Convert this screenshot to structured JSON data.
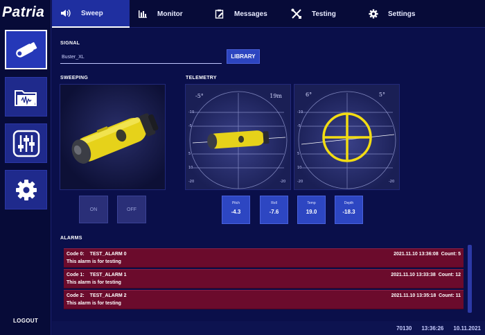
{
  "brand": {
    "logo_text": "Patria"
  },
  "rail": {
    "items": [
      {
        "name": "torpedo",
        "icon": "torpedo-icon",
        "active": true
      },
      {
        "name": "signal-library",
        "icon": "folder-waveform-icon",
        "active": false
      },
      {
        "name": "mixer",
        "icon": "sliders-icon",
        "active": false
      },
      {
        "name": "settings",
        "icon": "gear-icon",
        "active": false
      }
    ],
    "logout_label": "LOGOUT"
  },
  "tabs": [
    {
      "label": "Sweep",
      "icon": "speaker-icon",
      "active": true
    },
    {
      "label": "Monitor",
      "icon": "bar-chart-icon",
      "active": false
    },
    {
      "label": "Messages",
      "icon": "clipboard-edit-icon",
      "active": false
    },
    {
      "label": "Testing",
      "icon": "tools-icon",
      "active": false
    },
    {
      "label": "Settings",
      "icon": "gear-icon",
      "active": false
    }
  ],
  "signal": {
    "section_label": "SIGNAL",
    "value": "Buster_XL",
    "library_button": "LIBRARY"
  },
  "sweeping": {
    "section_label": "SWEEPING",
    "on_label": "ON",
    "off_label": "OFF"
  },
  "telemetry": {
    "section_label": "TELEMETRY",
    "gauge_left": {
      "roll_mark": "-5°",
      "depth_mark": "19m"
    },
    "gauge_right": {
      "left_mark": "6°",
      "right_mark": "5°"
    },
    "readouts": [
      {
        "label": "Pitch",
        "value": "-4.3"
      },
      {
        "label": "Roll",
        "value": "-7.6"
      },
      {
        "label": "Temp",
        "value": "19.0"
      },
      {
        "label": "Depth",
        "value": "-18.3"
      }
    ]
  },
  "alarms": {
    "section_label": "ALARMS",
    "items": [
      {
        "code": "Code 0:",
        "name": "TEST_ALARM 0",
        "timestamp": "2021.11.10 13:36:08",
        "count": "Count: 5",
        "message": "This alarm is for testing"
      },
      {
        "code": "Code 1:",
        "name": "TEST_ALARM 1",
        "timestamp": "2021.11.10 13:33:38",
        "count": "Count: 12",
        "message": "This alarm is for testing"
      },
      {
        "code": "Code 2:",
        "name": "TEST_ALARM 2",
        "timestamp": "2021.11.10 13:35:18",
        "count": "Count: 11",
        "message": "This alarm is for testing"
      }
    ]
  },
  "status": {
    "id": "70130",
    "time": "13:36:26",
    "date": "10.11.2021"
  },
  "colors": {
    "background": "#0a0f4a",
    "accent": "#2d45c0",
    "alarm": "#6b0b2c",
    "device_yellow": "#e6d21a"
  }
}
